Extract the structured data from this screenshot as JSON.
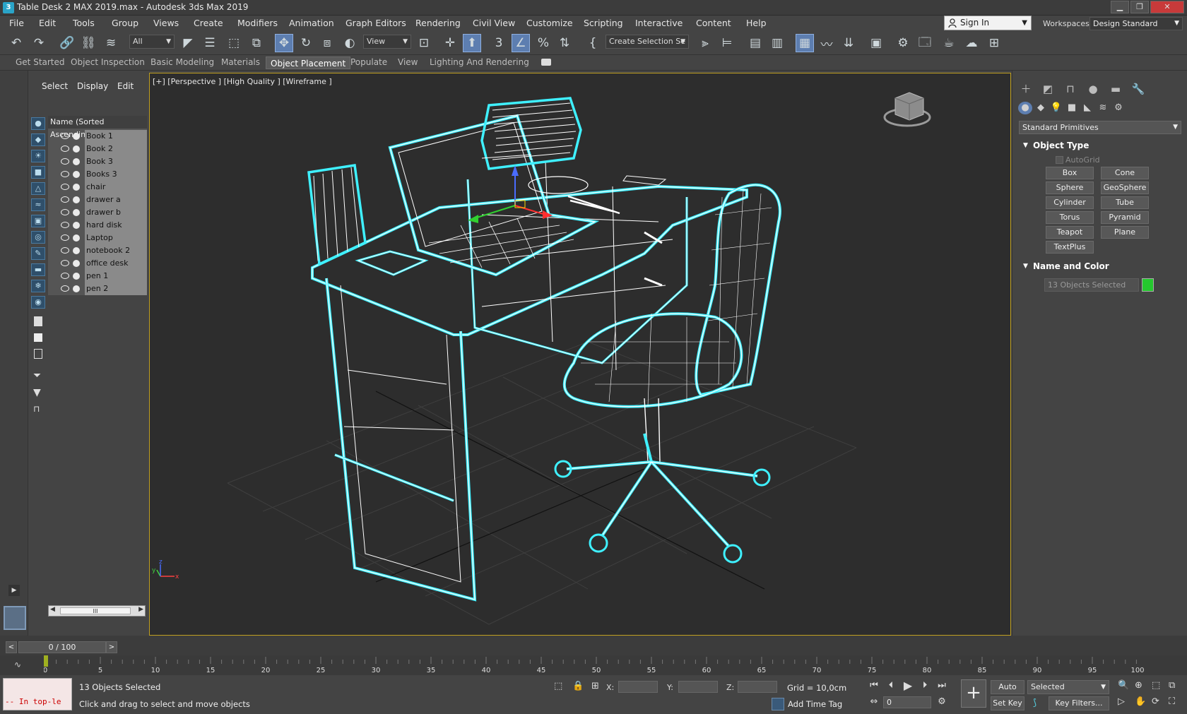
{
  "window": {
    "title": "Table Desk 2 MAX 2019.max - Autodesk 3ds Max 2019",
    "app_icon": "3ds-max-icon"
  },
  "menu": {
    "items": [
      "File",
      "Edit",
      "Tools",
      "Group",
      "Views",
      "Create",
      "Modifiers",
      "Animation",
      "Graph Editors",
      "Rendering",
      "Civil View",
      "Customize",
      "Scripting",
      "Interactive",
      "Content",
      "Help"
    ],
    "sign_in": "Sign In",
    "workspaces_label": "Workspaces:",
    "workspace": "Design Standard"
  },
  "toolbar": {
    "selection_filter": "All",
    "ref_coord": "View",
    "selection_set": "Create Selection Se",
    "snap_3": "3"
  },
  "ribbon": {
    "tabs": [
      "Get Started",
      "Object Inspection",
      "Basic Modeling",
      "Materials",
      "Object Placement",
      "Populate",
      "View",
      "Lighting And Rendering"
    ],
    "active": "Object Placement"
  },
  "scene_explorer": {
    "tabs": [
      "Select",
      "Display",
      "Edit"
    ],
    "header": "Name (Sorted Ascending)",
    "objects": [
      "Book 1",
      "Book 2",
      "Book 3",
      "Books 3",
      "chair",
      "drawer a",
      "drawer b",
      "hard disk",
      "Laptop",
      "notebook 2",
      "office desk",
      "pen 1",
      "pen 2"
    ],
    "scroll_label": "III"
  },
  "viewport": {
    "label": "[+] [Perspective ] [High Quality ] [Wireframe ]",
    "axis_x": "x",
    "axis_y": "y",
    "axis_z": "z",
    "selection_color": "#3ff0ff"
  },
  "command_panel": {
    "category": "Standard Primitives",
    "object_type_title": "Object Type",
    "autogrid": "AutoGrid",
    "buttons": [
      "Box",
      "Cone",
      "Sphere",
      "GeoSphere",
      "Cylinder",
      "Tube",
      "Torus",
      "Pyramid",
      "Teapot",
      "Plane",
      "TextPlus"
    ],
    "name_color_title": "Name and Color",
    "name_field": "13 Objects Selected",
    "object_color": "#25c82e"
  },
  "timeline": {
    "frame": "0 / 100",
    "ticks": [
      "0",
      "5",
      "10",
      "15",
      "20",
      "25",
      "30",
      "35",
      "40",
      "45",
      "50",
      "55",
      "60",
      "65",
      "70",
      "75",
      "80",
      "85",
      "90",
      "95",
      "100"
    ]
  },
  "status": {
    "maxscript_line": "-- In top-le",
    "selected": "13 Objects Selected",
    "prompt": "Click and drag to select and move objects",
    "x_label": "X:",
    "y_label": "Y:",
    "z_label": "Z:",
    "grid": "Grid = 10,0cm",
    "add_time_tag": "Add Time Tag",
    "auto_key": "Auto Key",
    "set_key": "Set Key",
    "key_mode": "Selected",
    "key_filters": "Key Filters...",
    "current_frame": "0"
  }
}
